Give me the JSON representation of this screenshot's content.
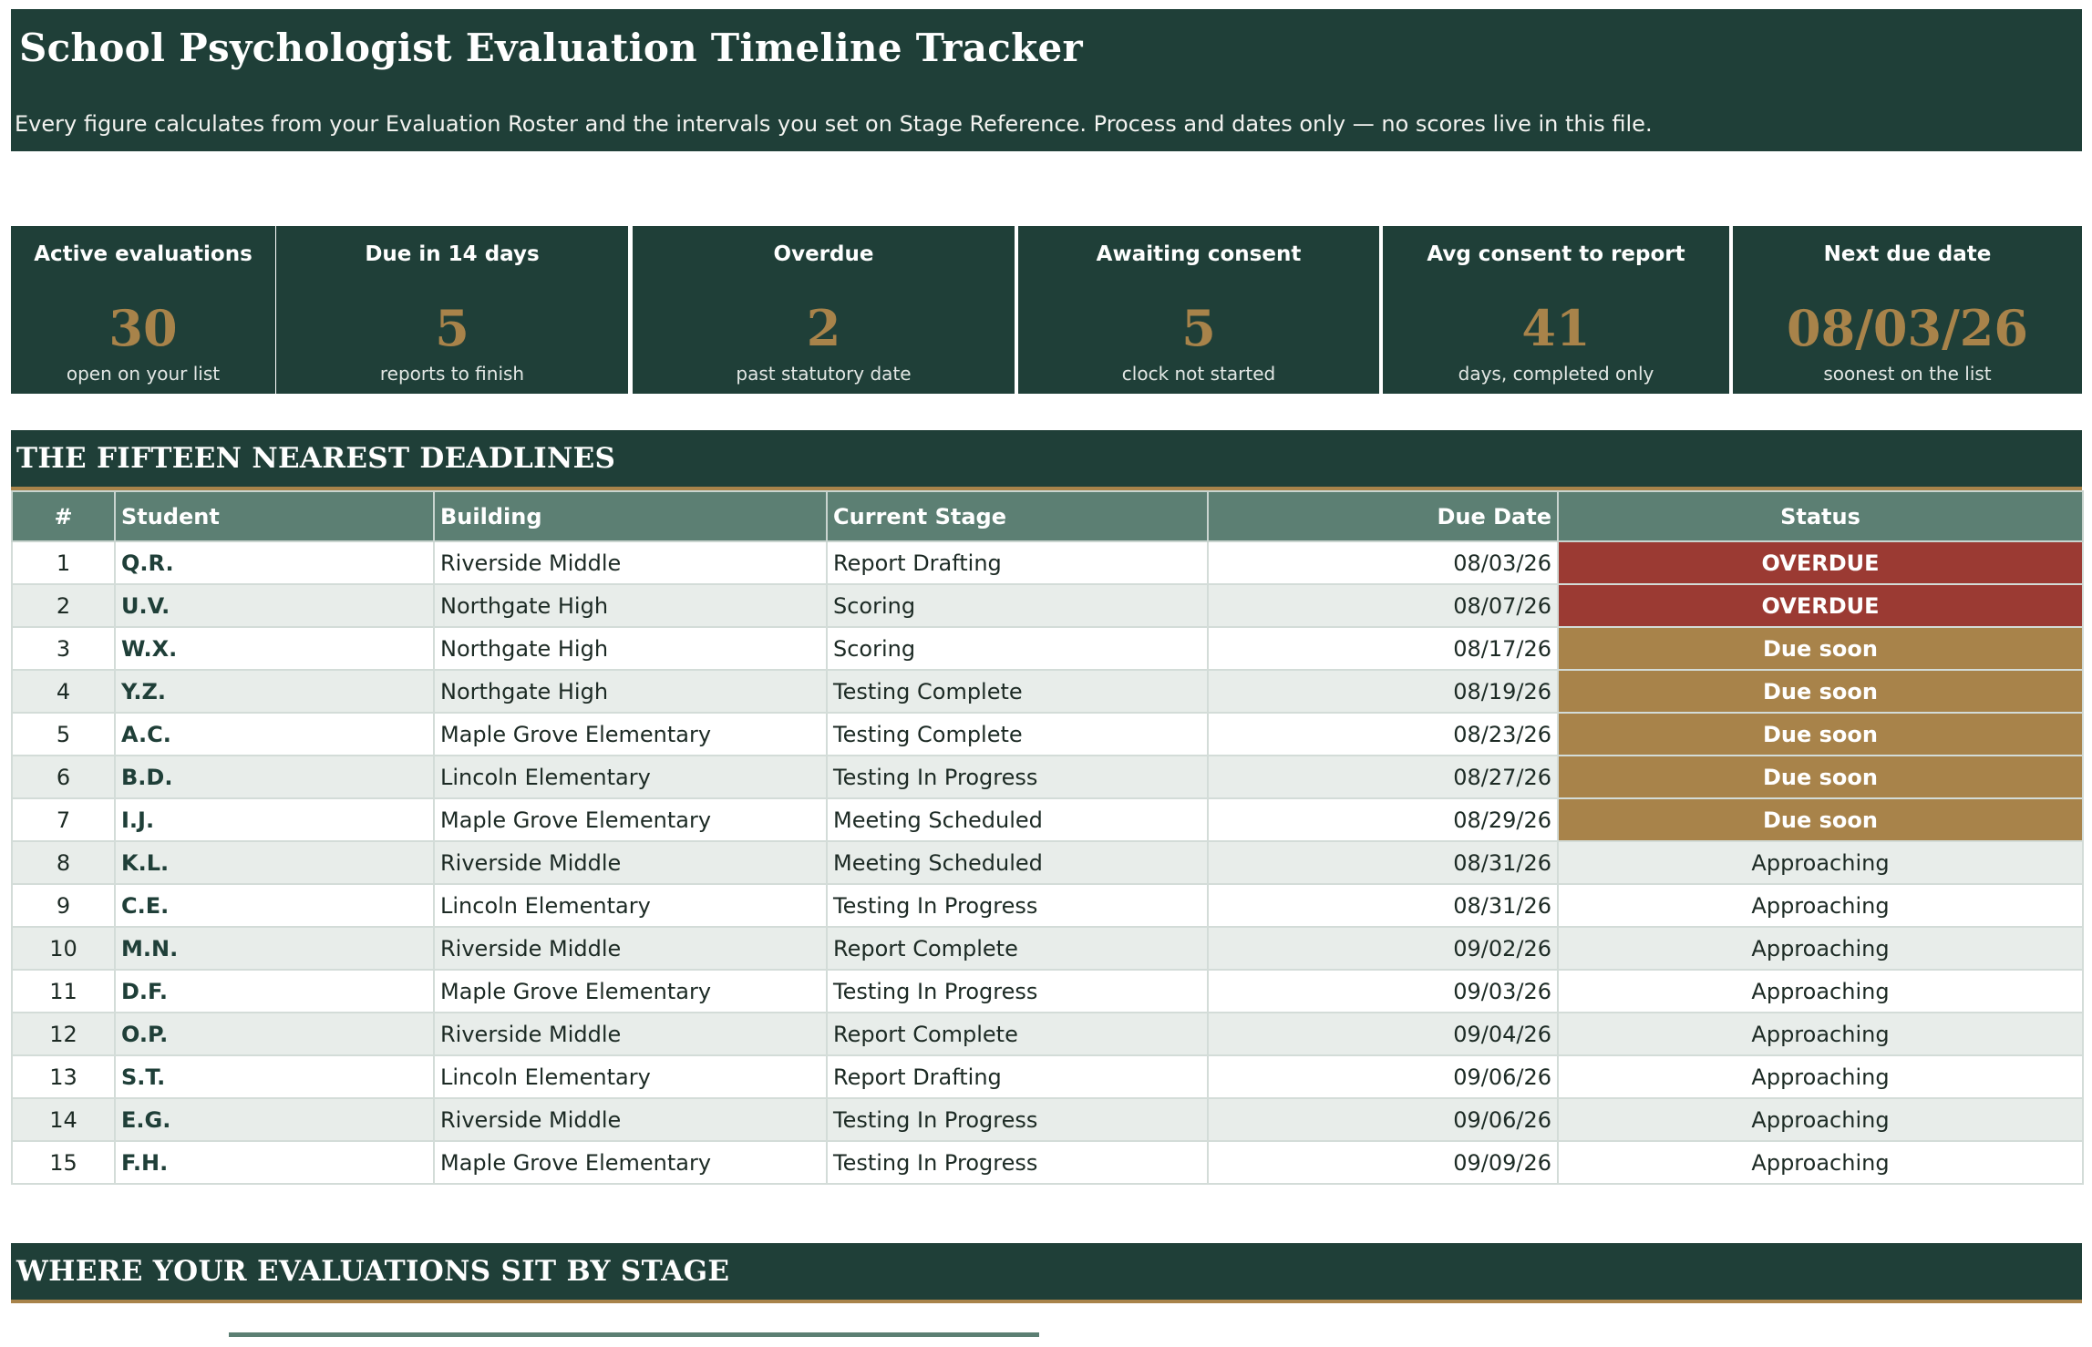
{
  "header": {
    "title": "School Psychologist Evaluation Timeline Tracker",
    "subtitle": "Every figure calculates from your Evaluation Roster and the intervals you set on Stage Reference. Process and dates only — no scores live in this file."
  },
  "kpis": [
    {
      "label": "Active evaluations",
      "value": "30",
      "note": "open on your list"
    },
    {
      "label": "Due in 14 days",
      "value": "5",
      "note": "reports to finish"
    },
    {
      "label": "Overdue",
      "value": "2",
      "note": "past statutory date"
    },
    {
      "label": "Awaiting consent",
      "value": "5",
      "note": "clock not started"
    },
    {
      "label": "Avg consent to report",
      "value": "41",
      "note": "days, completed only"
    },
    {
      "label": "Next due date",
      "value": "08/03/26",
      "note": "soonest on the list"
    }
  ],
  "deadlines": {
    "section_title": "THE FIFTEEN NEAREST DEADLINES",
    "columns": [
      "#",
      "Student",
      "Building",
      "Current Stage",
      "Due Date",
      "Status"
    ],
    "rows": [
      {
        "num": "1",
        "student": "Q.R.",
        "building": "Riverside Middle",
        "stage": "Report Drafting",
        "due": "08/03/26",
        "status": "OVERDUE"
      },
      {
        "num": "2",
        "student": "U.V.",
        "building": "Northgate High",
        "stage": "Scoring",
        "due": "08/07/26",
        "status": "OVERDUE"
      },
      {
        "num": "3",
        "student": "W.X.",
        "building": "Northgate High",
        "stage": "Scoring",
        "due": "08/17/26",
        "status": "Due soon"
      },
      {
        "num": "4",
        "student": "Y.Z.",
        "building": "Northgate High",
        "stage": "Testing Complete",
        "due": "08/19/26",
        "status": "Due soon"
      },
      {
        "num": "5",
        "student": "A.C.",
        "building": "Maple Grove Elementary",
        "stage": "Testing Complete",
        "due": "08/23/26",
        "status": "Due soon"
      },
      {
        "num": "6",
        "student": "B.D.",
        "building": "Lincoln Elementary",
        "stage": "Testing In Progress",
        "due": "08/27/26",
        "status": "Due soon"
      },
      {
        "num": "7",
        "student": "I.J.",
        "building": "Maple Grove Elementary",
        "stage": "Meeting Scheduled",
        "due": "08/29/26",
        "status": "Due soon"
      },
      {
        "num": "8",
        "student": "K.L.",
        "building": "Riverside Middle",
        "stage": "Meeting Scheduled",
        "due": "08/31/26",
        "status": "Approaching"
      },
      {
        "num": "9",
        "student": "C.E.",
        "building": "Lincoln Elementary",
        "stage": "Testing In Progress",
        "due": "08/31/26",
        "status": "Approaching"
      },
      {
        "num": "10",
        "student": "M.N.",
        "building": "Riverside Middle",
        "stage": "Report Complete",
        "due": "09/02/26",
        "status": "Approaching"
      },
      {
        "num": "11",
        "student": "D.F.",
        "building": "Maple Grove Elementary",
        "stage": "Testing In Progress",
        "due": "09/03/26",
        "status": "Approaching"
      },
      {
        "num": "12",
        "student": "O.P.",
        "building": "Riverside Middle",
        "stage": "Report Complete",
        "due": "09/04/26",
        "status": "Approaching"
      },
      {
        "num": "13",
        "student": "S.T.",
        "building": "Lincoln Elementary",
        "stage": "Report Drafting",
        "due": "09/06/26",
        "status": "Approaching"
      },
      {
        "num": "14",
        "student": "E.G.",
        "building": "Riverside Middle",
        "stage": "Testing In Progress",
        "due": "09/06/26",
        "status": "Approaching"
      },
      {
        "num": "15",
        "student": "F.H.",
        "building": "Maple Grove Elementary",
        "stage": "Testing In Progress",
        "due": "09/09/26",
        "status": "Approaching"
      }
    ]
  },
  "stage_section": {
    "section_title": "WHERE YOUR EVALUATIONS SIT BY STAGE"
  },
  "colors": {
    "header_bg": "#1f3f38",
    "accent_gold": "#a8834a",
    "table_header_bg": "#5c7f73",
    "overdue": "#9b3a33",
    "due_soon": "#a8834a",
    "alt_row": "#e8edea"
  }
}
